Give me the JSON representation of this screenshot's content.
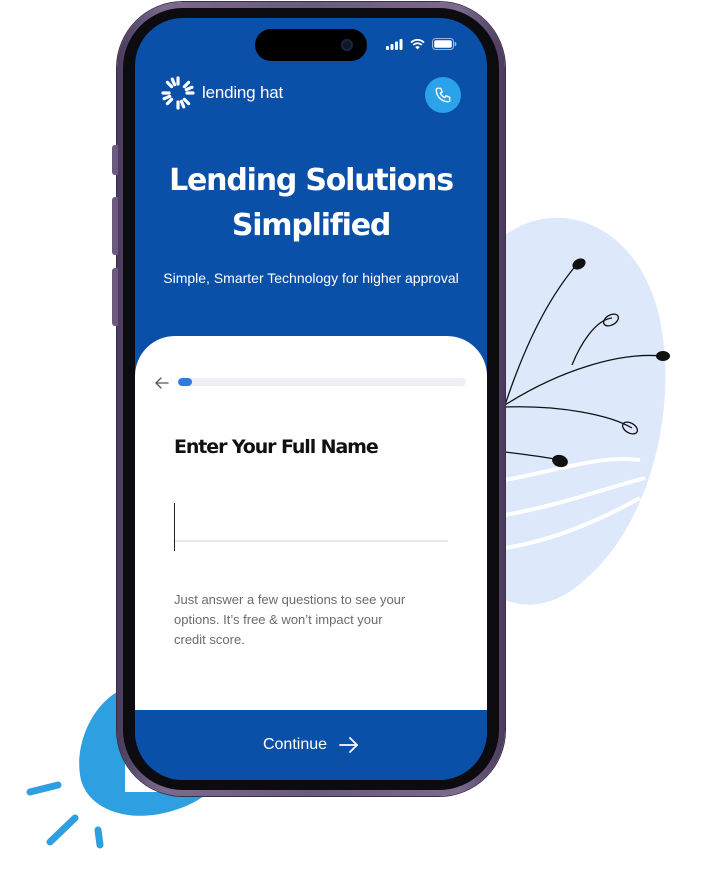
{
  "app": {
    "brand_name": "lending hat"
  },
  "icons": {
    "call": "phone-icon",
    "back": "arrow-left-icon",
    "continue": "arrow-right-icon",
    "signal": "cellular-signal-icon",
    "wifi": "wifi-icon",
    "battery": "battery-icon",
    "logo": "lending-hat-logo-icon"
  },
  "hero": {
    "headline_line1": "Lending Solutions",
    "headline_line2": "Simplified",
    "subtitle": "Simple, Smarter Technology for higher approval"
  },
  "form": {
    "progress_fraction": 0.05,
    "question": "Enter Your Full Name",
    "name_value": "",
    "helper_line1": "Just answer a few questions to see your",
    "helper_line2": "options. It’s free & won’t impact your",
    "helper_line3": "credit score."
  },
  "footer": {
    "continue_label": "Continue"
  },
  "colors": {
    "primary_blue": "#0a4fa8",
    "accent_blue": "#2aa3ea",
    "progress_blue": "#2f7be6",
    "blob_light": "#dde8fb",
    "blob_bright": "#2e9fe0"
  }
}
